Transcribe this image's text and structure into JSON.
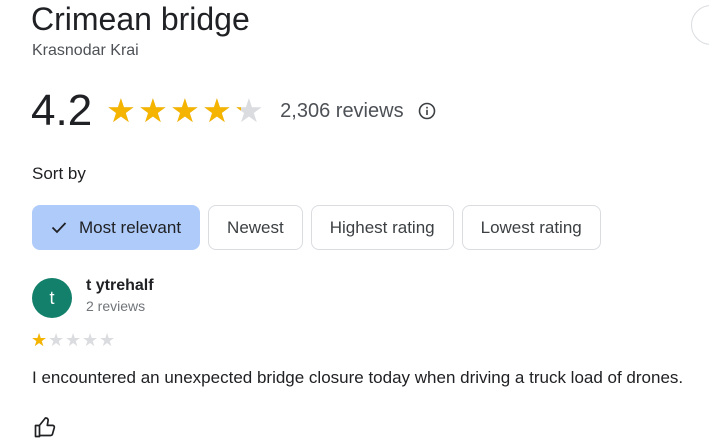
{
  "place": {
    "title": "Crimean bridge",
    "subtitle": "Krasnodar Krai"
  },
  "rating": {
    "value": "4.2",
    "stars": 4.2,
    "reviews_label": "2,306 reviews",
    "info_icon": "info-icon"
  },
  "sort": {
    "label": "Sort by",
    "options": [
      {
        "label": "Most relevant",
        "selected": true,
        "icon": "check-icon"
      },
      {
        "label": "Newest",
        "selected": false
      },
      {
        "label": "Highest rating",
        "selected": false
      },
      {
        "label": "Lowest rating",
        "selected": false
      }
    ]
  },
  "review": {
    "avatar_initial": "t",
    "avatar_color": "#12806a",
    "author": "t ytrehalf",
    "author_meta": "2 reviews",
    "stars": 1,
    "text": "I encountered an unexpected bridge closure today when driving a truck load of drones.",
    "like_icon": "thumbs-up-icon"
  },
  "colors": {
    "star": "#f4b400",
    "star_empty": "#dadce0",
    "selected_chip": "#aecbfa"
  }
}
